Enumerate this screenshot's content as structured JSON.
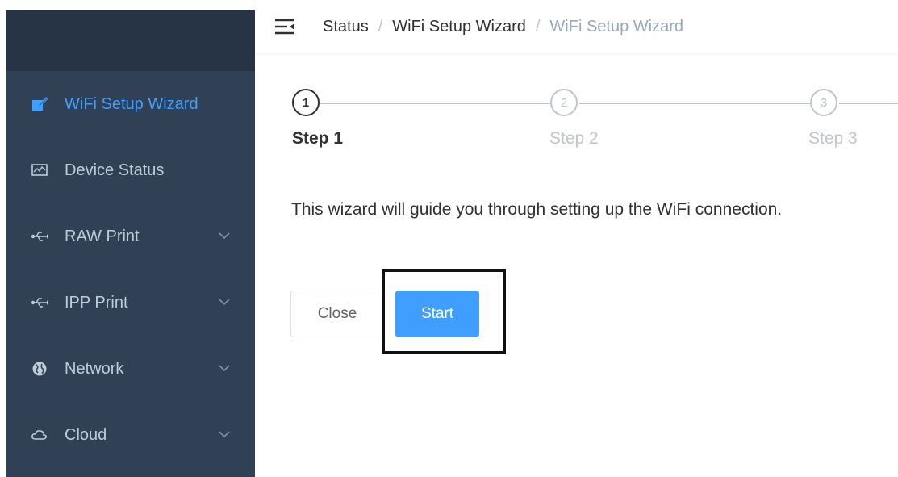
{
  "sidebar": {
    "items": [
      {
        "label": "WiFi Setup Wizard",
        "icon": "edit-icon",
        "active": true
      },
      {
        "label": "Device Status",
        "icon": "monitor-icon",
        "active": false
      },
      {
        "label": "RAW Print",
        "icon": "usb-icon",
        "active": false,
        "expandable": true
      },
      {
        "label": "IPP Print",
        "icon": "usb-icon",
        "active": false,
        "expandable": true
      },
      {
        "label": "Network",
        "icon": "globe-icon",
        "active": false,
        "expandable": true
      },
      {
        "label": "Cloud",
        "icon": "cloud-icon",
        "active": false,
        "expandable": true
      }
    ]
  },
  "navbar": {
    "breadcrumb": [
      "Status",
      "WiFi Setup Wizard",
      "WiFi Setup Wizard"
    ],
    "separator": "/"
  },
  "steps": [
    {
      "number": "1",
      "title": "Step 1",
      "active": true
    },
    {
      "number": "2",
      "title": "Step 2",
      "active": false
    },
    {
      "number": "3",
      "title": "Step 3",
      "active": false
    }
  ],
  "content": {
    "description": "This wizard will guide you through setting up the WiFi connection."
  },
  "buttons": {
    "close": "Close",
    "start": "Start"
  },
  "colors": {
    "sidebar_bg": "#304156",
    "sidebar_header_bg": "#263445",
    "accent": "#409eff",
    "sidebar_text": "#bfcbd9",
    "inactive_step": "#c0c4cc"
  }
}
